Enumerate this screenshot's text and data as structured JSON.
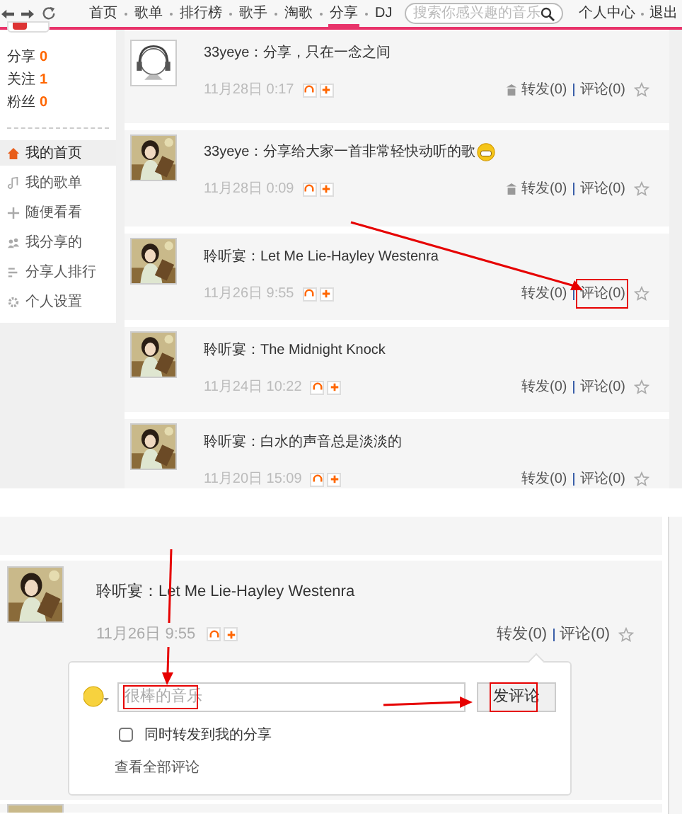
{
  "nav": {
    "links": [
      {
        "label": "首页",
        "selected": false
      },
      {
        "label": "歌单",
        "selected": false
      },
      {
        "label": "排行榜",
        "selected": false
      },
      {
        "label": "歌手",
        "selected": false
      },
      {
        "label": "淘歌",
        "selected": false
      },
      {
        "label": "分享",
        "selected": true
      },
      {
        "label": "DJ",
        "selected": false
      }
    ],
    "search": {
      "placeholder": "搜索你感兴趣的音乐"
    },
    "user_links": [
      "个人中心",
      "退出"
    ]
  },
  "sidebar": {
    "stats": [
      {
        "label": "分享",
        "count": "0"
      },
      {
        "label": "关注",
        "count": "1"
      },
      {
        "label": "粉丝",
        "count": "0"
      }
    ],
    "menu": [
      {
        "label": "我的首页",
        "selected": true
      },
      {
        "label": "我的歌单",
        "selected": false
      },
      {
        "label": "随便看看",
        "selected": false
      },
      {
        "label": "我分享的",
        "selected": false
      },
      {
        "label": "分享人排行",
        "selected": false
      },
      {
        "label": "个人设置",
        "selected": false
      }
    ]
  },
  "feed": [
    {
      "kind": "cartoon",
      "text": "33yeye：分享，只在一念之间",
      "emoji": false,
      "date": "11月28日 0:17",
      "delete": true,
      "repost": "转发(0)",
      "comment": "评论(0)",
      "highlight": false
    },
    {
      "kind": "picture",
      "text": "33yeye：分享给大家一首非常轻快动听的歌",
      "emoji": true,
      "date": "11月28日 0:09",
      "delete": true,
      "repost": "转发(0)",
      "comment": "评论(0)",
      "highlight": false
    },
    {
      "kind": "picture",
      "text": "聆听宴：Let Me Lie-Hayley Westenra",
      "emoji": false,
      "date": "11月26日 9:55",
      "delete": false,
      "repost": "转发(0)",
      "comment": "评论(0)",
      "highlight": true
    },
    {
      "kind": "picture",
      "text": "聆听宴：The Midnight Knock",
      "emoji": false,
      "date": "11月24日 10:22",
      "delete": false,
      "repost": "转发(0)",
      "comment": "评论(0)",
      "highlight": false
    },
    {
      "kind": "picture",
      "text": "聆听宴：白水的声音总是淡淡的",
      "emoji": false,
      "date": "11月20日 15:09",
      "delete": false,
      "repost": "转发(0)",
      "comment": "评论(0)",
      "highlight": false
    }
  ],
  "detail": {
    "text": "聆听宴：Let Me Lie-Hayley Westenra",
    "date": "11月26日 9:55",
    "repost": "转发(0)",
    "comment": "评论(0)",
    "comment_box": {
      "placeholder": "很棒的音乐",
      "button": "发评论",
      "repost_option": {
        "label": "同时转发到我的分享",
        "checked": false
      },
      "view_all": "查看全部评论"
    }
  }
}
